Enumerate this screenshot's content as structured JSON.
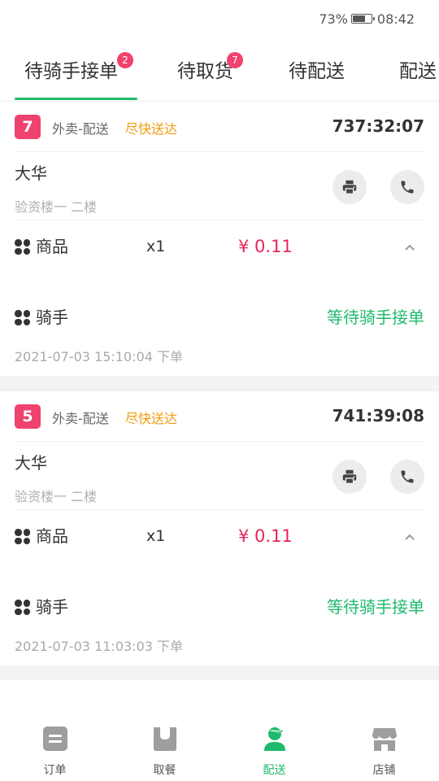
{
  "status_bar": {
    "battery_percent": "73%",
    "battery_level": 0.73,
    "time": "08:42"
  },
  "tabs": [
    {
      "label": "待骑手接单",
      "badge": "2",
      "active": true
    },
    {
      "label": "待取货",
      "badge": "7",
      "active": false
    },
    {
      "label": "待配送",
      "badge": "",
      "active": false
    },
    {
      "label": "配送",
      "badge": "",
      "active": false
    }
  ],
  "orders": [
    {
      "number": "7",
      "type": "外卖-配送",
      "urgency": "尽快送达",
      "timer": "737:32:07",
      "customer_name": "大华",
      "address": "验资楼一 二楼",
      "goods_label": "商品",
      "goods_qty": "x1",
      "goods_price": "¥ 0.11",
      "rider_label": "骑手",
      "rider_status": "等待骑手接单",
      "order_time": "2021-07-03 15:10:04 下单"
    },
    {
      "number": "5",
      "type": "外卖-配送",
      "urgency": "尽快送达",
      "timer": "741:39:08",
      "customer_name": "大华",
      "address": "验资楼一 二楼",
      "goods_label": "商品",
      "goods_qty": "x1",
      "goods_price": "¥ 0.11",
      "rider_label": "骑手",
      "rider_status": "等待骑手接单",
      "order_time": "2021-07-03 11:03:03 下单"
    }
  ],
  "icons": {
    "print": "printer-icon",
    "phone": "phone-icon",
    "goods": "grid-dots-icon",
    "rider": "grid-dots-icon",
    "collapse": "chevron-up-icon"
  },
  "bottom_nav": [
    {
      "label": "订单",
      "icon": "order-icon",
      "active": false
    },
    {
      "label": "取餐",
      "icon": "pickup-bag-icon",
      "active": false
    },
    {
      "label": "配送",
      "icon": "courier-icon",
      "active": true
    },
    {
      "label": "店铺",
      "icon": "shop-icon",
      "active": false
    }
  ],
  "colors": {
    "accent": "#1fba6c",
    "badge": "#f0426e",
    "urgency": "#f39c11",
    "price": "#e6265a"
  }
}
